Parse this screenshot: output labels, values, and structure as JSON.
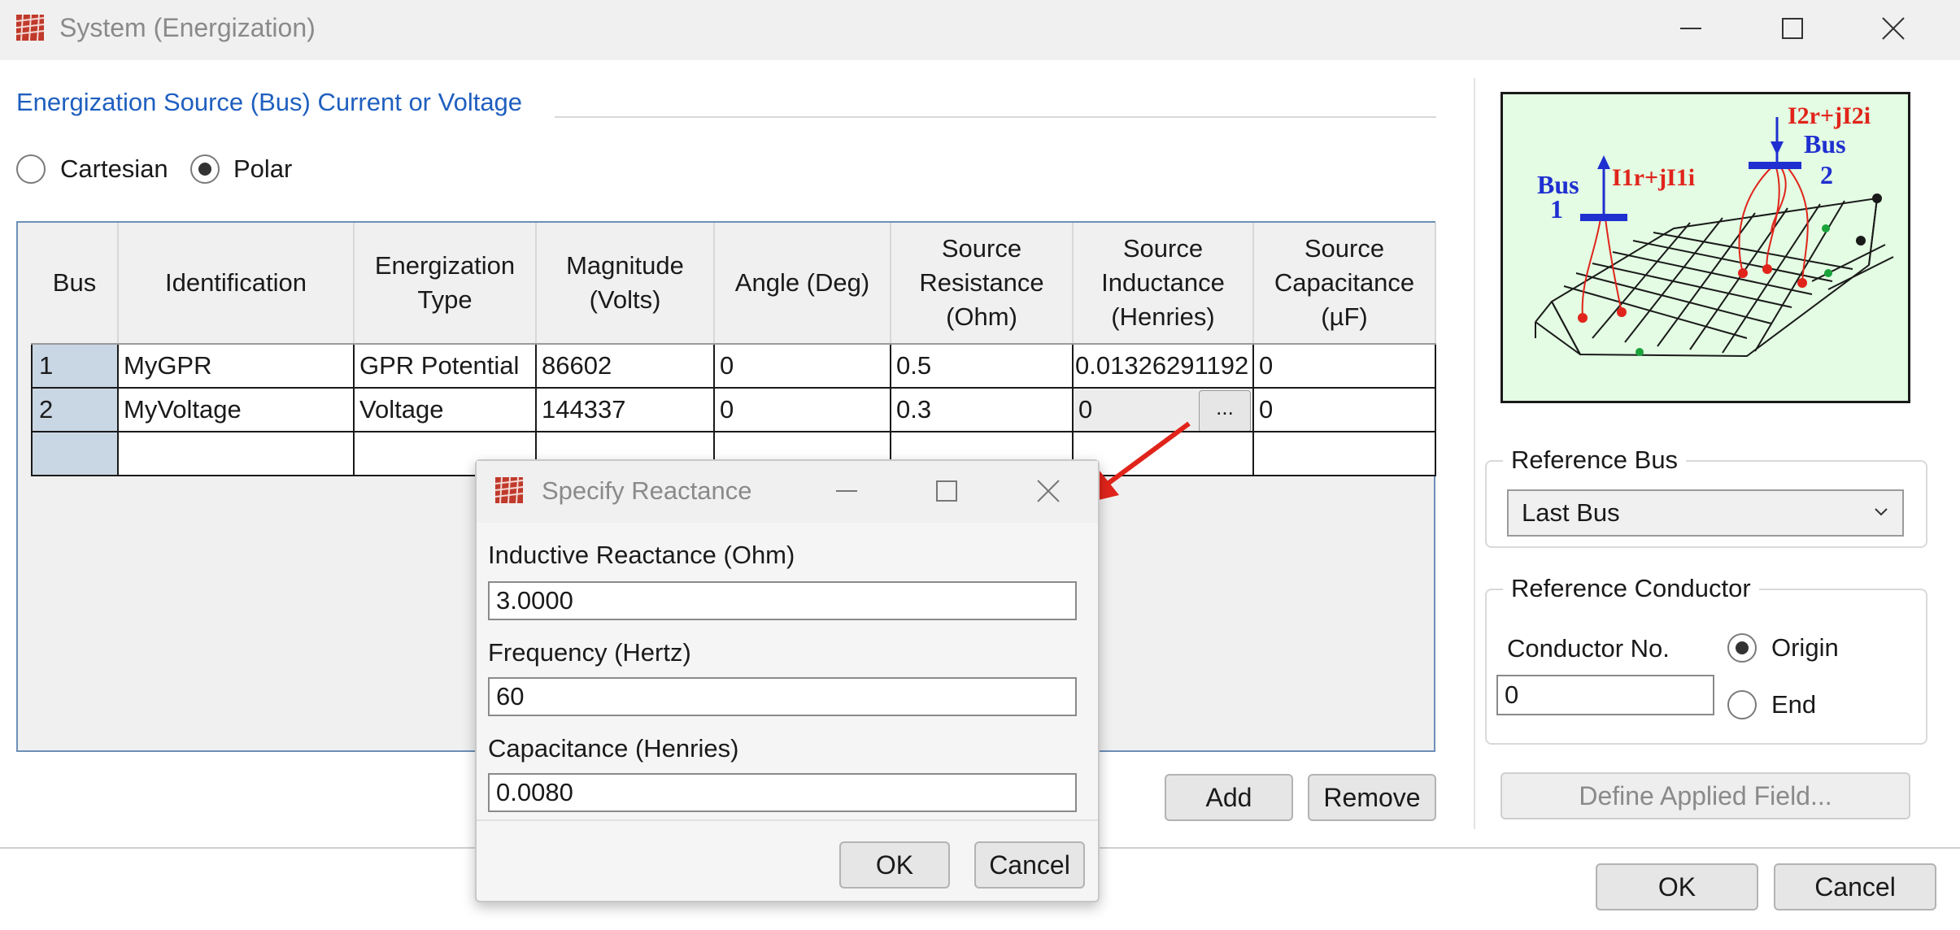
{
  "window": {
    "title": "System (Energization)",
    "app_icon": "grid-mesh-icon",
    "controls": [
      "minimize-icon",
      "maximize-icon",
      "close-icon"
    ]
  },
  "section": {
    "title": "Energization Source (Bus) Current or Voltage"
  },
  "coordinate_mode": {
    "options": [
      "Cartesian",
      "Polar"
    ],
    "selected": "Polar"
  },
  "grid": {
    "columns": [
      "Bus",
      "Identification",
      "Energization\nType",
      "Magnitude\n(Volts)",
      "Angle (Deg)",
      "Source\nResistance\n(Ohm)",
      "Source\nInductance\n(Henries)",
      "Source\nCapacitance\n(µF)"
    ],
    "rows": [
      [
        "1",
        "MyGPR",
        "GPR Potential",
        "86602",
        "0",
        "0.5",
        "0.01326291192",
        "0"
      ],
      [
        "2",
        "MyVoltage",
        "Voltage",
        "144337",
        "0",
        "0.3",
        "0",
        "0"
      ],
      [
        "",
        "",
        "",
        "",
        "",
        "",
        "",
        ""
      ]
    ],
    "ellipsis_label": "..."
  },
  "buttons": {
    "add": "Add",
    "remove": "Remove",
    "ok": "OK",
    "cancel": "Cancel",
    "define_field": "Define Applied Field..."
  },
  "diagram": {
    "bus1_label": "Bus",
    "bus1_num": "1",
    "bus2_label": "Bus",
    "bus2_num": "2",
    "current1": "I1r+jI1i",
    "current2": "I2r+jI2i"
  },
  "reference_bus": {
    "title": "Reference Bus",
    "selected": "Last Bus"
  },
  "reference_conductor": {
    "title": "Reference Conductor",
    "conductor_label": "Conductor No.",
    "conductor_value": "0",
    "options": [
      "Origin",
      "End"
    ],
    "selected": "Origin"
  },
  "popup": {
    "title": "Specify Reactance",
    "fields": [
      {
        "label": "Inductive Reactance (Ohm)",
        "value": "3.0000"
      },
      {
        "label": "Frequency (Hertz)",
        "value": "60"
      },
      {
        "label": "Capacitance (Henries)",
        "value": "0.0080"
      }
    ],
    "ok": "OK",
    "cancel": "Cancel"
  },
  "colors": {
    "accent_blue": "#1f5fbf",
    "arrow_red": "#e0241b",
    "diagram_bg": "#e3fce3",
    "row_header": "#c9d6e4"
  }
}
